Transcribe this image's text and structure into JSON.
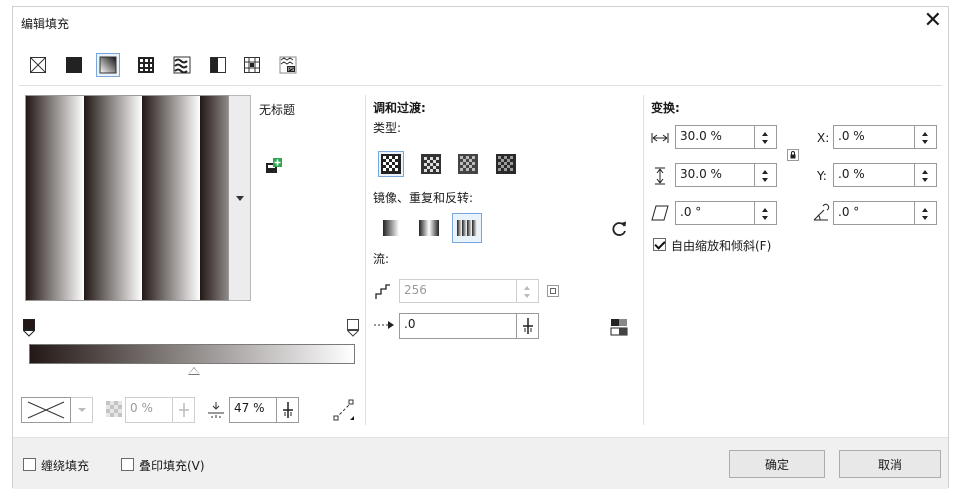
{
  "dialog": {
    "title": "编辑填充",
    "close_glyph": "✕"
  },
  "fill_types": [
    {
      "name": "no-fill-icon"
    },
    {
      "name": "uniform-fill-icon"
    },
    {
      "name": "fountain-fill-icon",
      "active": true
    },
    {
      "name": "vector-pattern-icon"
    },
    {
      "name": "bitmap-pattern-icon"
    },
    {
      "name": "two-color-pattern-icon"
    },
    {
      "name": "texture-fill-icon"
    },
    {
      "name": "postscript-fill-icon"
    }
  ],
  "preview": {
    "name_label": "无标题"
  },
  "blend": {
    "heading": "调和过渡:",
    "type_label": "类型:",
    "mirror_label": "镜像、重复和反转:",
    "flow_label": "流:",
    "steps_value": "256",
    "acceleration_value": ".0"
  },
  "transform": {
    "heading": "变换:",
    "width_value": "30.0 %",
    "height_value": "30.0 %",
    "skew_value": ".0 °",
    "x_label": "X:",
    "x_value": ".0 %",
    "y_label": "Y:",
    "y_value": ".0 %",
    "rotate_value": ".0 °",
    "free_scale_label": "自由缩放和倾斜(F)",
    "free_scale_checked": true
  },
  "node_controls": {
    "transparency_value": "0 %",
    "position_value": "47 %"
  },
  "footer": {
    "wrap_fill_label": "缠绕填充",
    "overprint_fill_label": "叠印填充(V)",
    "ok_label": "确定",
    "cancel_label": "取消"
  },
  "colors": {
    "gradient_start": "#231815",
    "gradient_end": "#ffffff",
    "accent": "#7aa6d8",
    "add_badge": "#2fa84f"
  }
}
